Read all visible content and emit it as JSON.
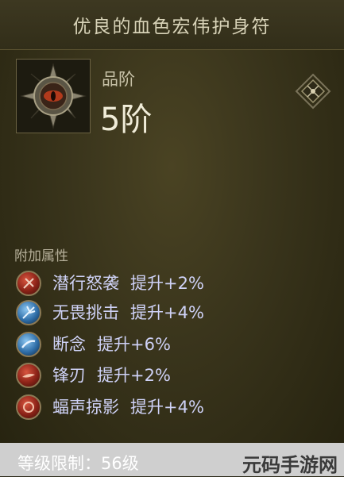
{
  "item": {
    "name": "优良的血色宏伟护身符",
    "grade_label": "品阶",
    "grade_value": "5阶"
  },
  "affixes": {
    "section_label": "附加属性",
    "items": [
      {
        "name": "潜行怒袭",
        "bonus": "提升+2%",
        "icon": "red-orb-icon"
      },
      {
        "name": "无畏挑击",
        "bonus": "提升+4%",
        "icon": "blue-orb-icon"
      },
      {
        "name": "断念",
        "bonus": "提升+6%",
        "icon": "blue-orb-icon"
      },
      {
        "name": "锋刃",
        "bonus": "提升+2%",
        "icon": "red-orb-icon"
      },
      {
        "name": "蝠声掠影",
        "bonus": "提升+4%",
        "icon": "red-orb-icon"
      }
    ]
  },
  "footer": {
    "level_requirement": "等级限制：56级",
    "watermark": "元码手游网"
  },
  "colors": {
    "affix_text": "#cfd2f7",
    "title_text": "#d8d3b8",
    "background": "#3a351c"
  }
}
